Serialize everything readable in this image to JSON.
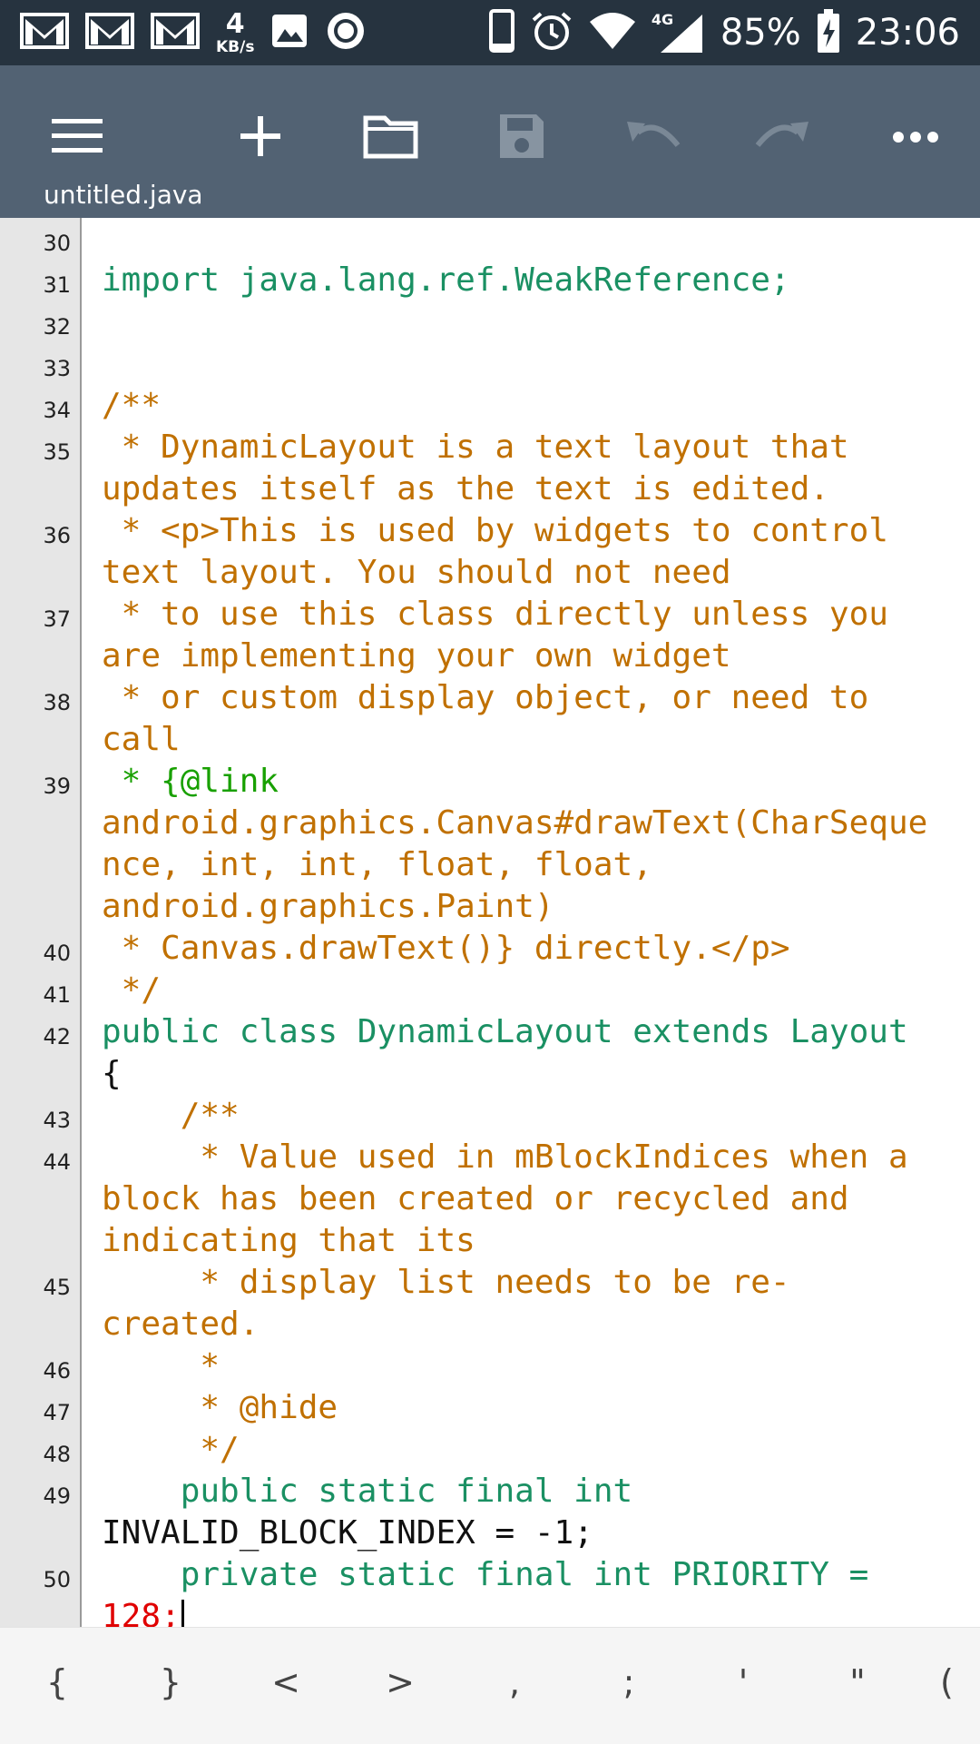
{
  "status_bar": {
    "speed_value": "4",
    "speed_unit": "KB/s",
    "network": "4G",
    "battery": "85%",
    "time": "23:06",
    "icons": [
      "gmail-icon",
      "gmail-icon",
      "gmail-icon",
      "image-icon",
      "record-icon",
      "phone-icon",
      "alarm-icon",
      "wifi-icon",
      "signal-icon",
      "battery-charging-icon"
    ]
  },
  "toolbar": {
    "file_name": "untitled.java",
    "buttons": [
      "menu-icon",
      "add-icon",
      "folder-icon",
      "save-icon",
      "undo-icon",
      "redo-icon",
      "more-icon"
    ]
  },
  "editor": {
    "line_numbers": [
      "30",
      "31",
      "32",
      "33",
      "34",
      "35",
      "36",
      "37",
      "38",
      "39",
      "40",
      "41",
      "42",
      "43",
      "44",
      "45",
      "46",
      "47",
      "48",
      "49",
      "50"
    ],
    "code_rows": [
      "",
      "import java.lang.ref.WeakReference;",
      "",
      "",
      "/**",
      " * DynamicLayout is a text layout that",
      "updates itself as the text is edited.",
      " * <p>This is used by widgets to control",
      "text layout. You should not need",
      " * to use this class directly unless you",
      "are implementing your own widget",
      " * or custom display object, or need to",
      "call",
      " * {@link",
      "android.graphics.Canvas#drawText(CharSeque",
      "nce, int, int, float, float,",
      "android.graphics.Paint)",
      " * Canvas.drawText()} directly.</p>",
      " */",
      "public class DynamicLayout extends Layout",
      "{",
      "    /**",
      "     * Value used in mBlockIndices when a",
      "block has been created or recycled and",
      "indicating that its",
      "     * display list needs to be re-",
      "created.",
      "     *",
      "     * @hide",
      "     */",
      "    public static final int",
      "INVALID_BLOCK_INDEX = -1;",
      "    private static final int PRIORITY =",
      "128;"
    ]
  },
  "symbol_bar": {
    "keys": [
      "{",
      "}",
      "<",
      ">",
      ",",
      ";",
      "'",
      "\"",
      "("
    ]
  },
  "colors": {
    "status_bar": "#26333f",
    "toolbar": "#526273",
    "keyword": "#1a9063",
    "type": "#1d8fd0",
    "comment": "#c07000",
    "javadoc_tag": "#18a000",
    "number": "#e00000"
  }
}
